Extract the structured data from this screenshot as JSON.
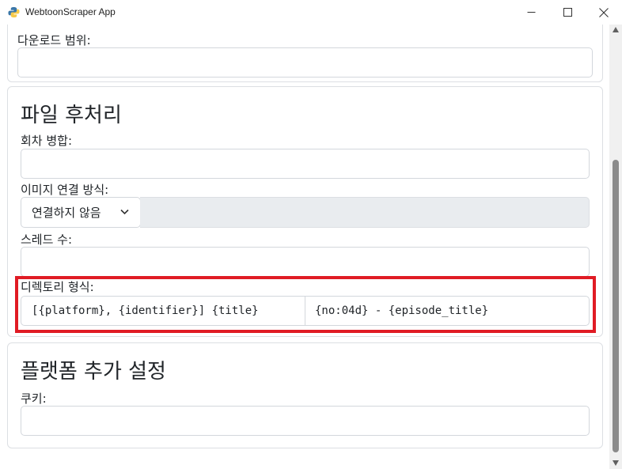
{
  "window": {
    "title": "WebtoonScraper App",
    "icon": "python-icon"
  },
  "download_range": {
    "label": "다운로드 범위:",
    "value": ""
  },
  "post_processing": {
    "title": "파일 후처리",
    "merge_label": "회차 병합:",
    "merge_value": "",
    "image_concat_label": "이미지 연결 방식:",
    "image_concat_selected": "연결하지 않음",
    "threads_label": "스레드 수:",
    "threads_value": "",
    "directory_label": "디렉토리 형식:",
    "directory_format_1": "[{platform}, {identifier}] {title}",
    "directory_format_2": "{no:04d} - {episode_title}"
  },
  "platform_settings": {
    "title": "플랫폼 추가 설정",
    "cookie_label": "쿠키:",
    "cookie_value": ""
  },
  "colors": {
    "highlight": "#e01b24",
    "border": "#d3d7dc",
    "disabled_bg": "#e9ecef"
  }
}
